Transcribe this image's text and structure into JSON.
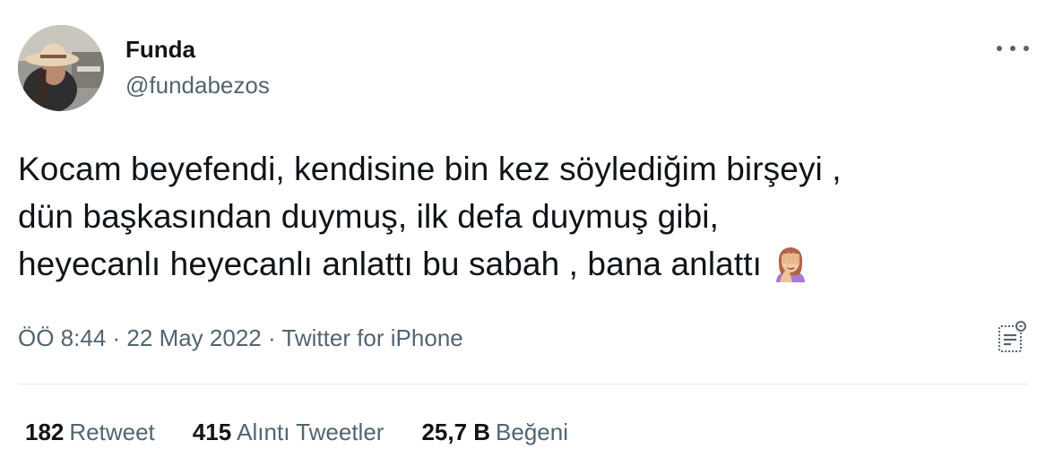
{
  "author": {
    "name": "Funda",
    "handle": "@fundabezos",
    "avatar_icon": "profile-photo-woman-with-hat"
  },
  "menu": {
    "more_icon": "more-horizontal-icon"
  },
  "tweet": {
    "lines": [
      "Kocam beyefendi, kendisine bin kez söylediğim birşeyi ,",
      "dün başkasından duymuş, ilk defa duymuş gibi,",
      "heyecanlı heyecanlı anlattı bu sabah , bana anlattı"
    ],
    "emoji": "woman-facepalming-emoji"
  },
  "meta": {
    "time": "ÖÖ 8:44",
    "date": "22 May 2022",
    "separator": "·",
    "source": "Twitter for iPhone",
    "analytics_icon": "tweet-analytics-icon"
  },
  "stats": {
    "retweets": {
      "count": "182",
      "label": "Retweet"
    },
    "quotes": {
      "count": "415",
      "label": "Alıntı Tweetler"
    },
    "likes": {
      "count": "25,7 B",
      "label": "Beğeni"
    }
  },
  "colors": {
    "text_primary": "#0f1419",
    "text_secondary": "#536471",
    "divider": "#e6e9eb",
    "background": "#ffffff"
  }
}
